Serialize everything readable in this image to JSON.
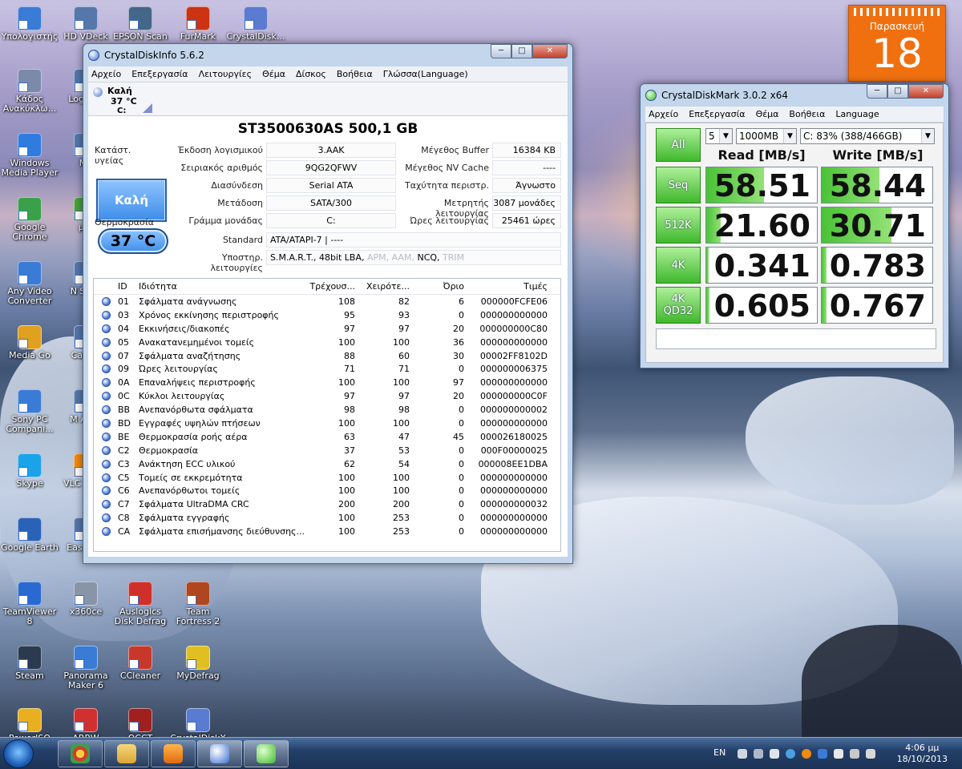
{
  "desktop": {
    "icons": [
      {
        "label": "Υπολογιστής",
        "name": "computer",
        "color": "#3a7bd5"
      },
      {
        "label": "HD VDeck",
        "name": "hd-vdeck",
        "color": "#5577aa"
      },
      {
        "label": "EPSON Scan",
        "name": "epson-scan",
        "color": "#446688"
      },
      {
        "label": "FurMark",
        "name": "furmark",
        "color": "#cc3311"
      },
      {
        "label": "CrystalDisk...",
        "name": "crystaldisk",
        "color": "#5a7bd0"
      },
      {
        "label": "Κάδος Ανακύκλω...",
        "name": "recycle-bin",
        "color": "#7a8aa8"
      },
      {
        "label": "Log Wel",
        "name": "log-wel",
        "color": "#5577aa"
      },
      {
        "label": "Windows Media Player",
        "name": "windows-media-player",
        "color": "#2f7be0"
      },
      {
        "label": "Mp",
        "name": "mp",
        "color": "#5577aa"
      },
      {
        "label": "Google Chrome",
        "name": "google-chrome",
        "color": "#3aa14a"
      },
      {
        "label": "µTo",
        "name": "utorrent",
        "color": "#4aa03a"
      },
      {
        "label": "Any Video Converter",
        "name": "any-video-converter",
        "color": "#3a7bd5"
      },
      {
        "label": "N Start",
        "name": "n-start",
        "color": "#5577aa"
      },
      {
        "label": "Media Go",
        "name": "media-go",
        "color": "#e0a020"
      },
      {
        "label": "Cat Co",
        "name": "cat-co",
        "color": "#5577aa"
      },
      {
        "label": "Sony PC Compani...",
        "name": "sony-pc-companion",
        "color": "#3a7bd5"
      },
      {
        "label": "M After",
        "name": "m-after",
        "color": "#5577aa"
      },
      {
        "label": "Skype",
        "name": "skype",
        "color": "#1aa3e8"
      },
      {
        "label": "VLC m pla",
        "name": "vlc",
        "color": "#f08a10"
      },
      {
        "label": "Google Earth",
        "name": "google-earth",
        "color": "#2a62b8"
      },
      {
        "label": "Eas Parti",
        "name": "eas-parti",
        "color": "#5577aa"
      },
      {
        "label": "TeamViewer 8",
        "name": "teamviewer",
        "color": "#2a6ad0"
      },
      {
        "label": "x360ce",
        "name": "x360ce",
        "color": "#8894a8"
      },
      {
        "label": "Auslogics Disk Defrag",
        "name": "auslogics",
        "color": "#d0302a"
      },
      {
        "label": "Team Fortress 2",
        "name": "team-fortress",
        "color": "#b0461e"
      },
      {
        "label": "Steam",
        "name": "steam",
        "color": "#2b3a4e"
      },
      {
        "label": "Panorama Maker 6",
        "name": "panorama-maker",
        "color": "#3a7bd5"
      },
      {
        "label": "CCleaner",
        "name": "ccleaner",
        "color": "#c8382a"
      },
      {
        "label": "MyDefrag",
        "name": "mydefrag",
        "color": "#e0c020"
      },
      {
        "label": "PowerISO",
        "name": "poweriso",
        "color": "#e8b020"
      },
      {
        "label": "ARRW",
        "name": "arrw",
        "color": "#d03030"
      },
      {
        "label": "OCCT",
        "name": "occt",
        "color": "#a02020"
      },
      {
        "label": "CrystalDiskX",
        "name": "crystaldiskx",
        "color": "#5a7bd0"
      }
    ]
  },
  "calendar": {
    "day": "Παρασκευή",
    "date": "18"
  },
  "cdi": {
    "title": "CrystalDiskInfo 5.6.2",
    "menu": [
      "Αρχείο",
      "Επεξεργασία",
      "Λειτουργίες",
      "Θέμα",
      "Δίσκος",
      "Βοήθεια",
      "Γλώσσα(Language)"
    ],
    "drive": {
      "status": "Καλή",
      "temp": "37 °C",
      "letter": "C:"
    },
    "model": "ST3500630AS  500,1 GB",
    "health_label": "Κατάστ. υγείας",
    "health_value": "Καλή",
    "temp_label": "Θερμοκρασία",
    "temp_value": "37 °C",
    "firmware_label": "Έκδοση λογισμικού",
    "firmware": "3.AAK",
    "serial_label": "Σειριακός αριθμός",
    "serial": "9QG2QFWV",
    "interface_label": "Διασύνδεση",
    "interface": "Serial ATA",
    "transfer_label": "Μετάδοση",
    "transfer": "SATA/300",
    "letter_label": "Γράμμα μονάδας",
    "letter": "C:",
    "standard_label": "Standard",
    "standard": "ATA/ATAPI-7 | ----",
    "features_label": "Υποστηρ. λειτουργίες",
    "features_active": "S.M.A.R.T., 48bit LBA,",
    "features_dim": " APM, AAM,",
    "features_active2": " NCQ,",
    "features_dim2": " TRIM",
    "buffer_label": "Μέγεθος Buffer",
    "buffer": "16384 KB",
    "nvcache_label": "Μέγεθος NV Cache",
    "nvcache": "----",
    "rotation_label": "Ταχύτητα περιστρ.",
    "rotation": "Άγνωστο",
    "powercount_label": "Μετρητής λειτουργίας",
    "powercount": "3087 μονάδες",
    "hours_label": "Ώρες λειτουργίας",
    "hours": "25461 ώρες",
    "columns": [
      "ID",
      "Ιδιότητα",
      "Τρέχουσ...",
      "Χειρότε...",
      "Όριο",
      "Τιμές"
    ],
    "attributes": [
      {
        "id": "01",
        "name": "Σφάλματα ανάγνωσης",
        "cur": "108",
        "worst": "82",
        "thr": "6",
        "raw": "000000FCFE06"
      },
      {
        "id": "03",
        "name": "Χρόνος εκκίνησης περιστροφής",
        "cur": "95",
        "worst": "93",
        "thr": "0",
        "raw": "000000000000"
      },
      {
        "id": "04",
        "name": "Εκκινήσεις/διακοπές",
        "cur": "97",
        "worst": "97",
        "thr": "20",
        "raw": "000000000C80"
      },
      {
        "id": "05",
        "name": "Ανακατανεμημένοι τομείς",
        "cur": "100",
        "worst": "100",
        "thr": "36",
        "raw": "000000000000"
      },
      {
        "id": "07",
        "name": "Σφάλματα αναζήτησης",
        "cur": "88",
        "worst": "60",
        "thr": "30",
        "raw": "00002FF8102D"
      },
      {
        "id": "09",
        "name": "Ώρες λειτουργίας",
        "cur": "71",
        "worst": "71",
        "thr": "0",
        "raw": "000000006375"
      },
      {
        "id": "0A",
        "name": "Επαναλήψεις περιστροφής",
        "cur": "100",
        "worst": "100",
        "thr": "97",
        "raw": "000000000000"
      },
      {
        "id": "0C",
        "name": "Κύκλοι λειτουργίας",
        "cur": "97",
        "worst": "97",
        "thr": "20",
        "raw": "000000000C0F"
      },
      {
        "id": "BB",
        "name": "Ανεπανόρθωτα σφάλματα",
        "cur": "98",
        "worst": "98",
        "thr": "0",
        "raw": "000000000002"
      },
      {
        "id": "BD",
        "name": "Εγγραφές υψηλών πτήσεων",
        "cur": "100",
        "worst": "100",
        "thr": "0",
        "raw": "000000000000"
      },
      {
        "id": "BE",
        "name": "Θερμοκρασία ροής αέρα",
        "cur": "63",
        "worst": "47",
        "thr": "45",
        "raw": "000026180025"
      },
      {
        "id": "C2",
        "name": "Θερμοκρασία",
        "cur": "37",
        "worst": "53",
        "thr": "0",
        "raw": "000F00000025"
      },
      {
        "id": "C3",
        "name": "Ανάκτηση ECC υλικού",
        "cur": "62",
        "worst": "54",
        "thr": "0",
        "raw": "000008EE1DBA"
      },
      {
        "id": "C5",
        "name": "Τομείς σε εκκρεμότητα",
        "cur": "100",
        "worst": "100",
        "thr": "0",
        "raw": "000000000000"
      },
      {
        "id": "C6",
        "name": "Ανεπανόρθωτοι τομείς",
        "cur": "100",
        "worst": "100",
        "thr": "0",
        "raw": "000000000000"
      },
      {
        "id": "C7",
        "name": "Σφάλματα UltraDMA CRC",
        "cur": "200",
        "worst": "200",
        "thr": "0",
        "raw": "000000000032"
      },
      {
        "id": "C8",
        "name": "Σφάλματα εγγραφής",
        "cur": "100",
        "worst": "253",
        "thr": "0",
        "raw": "000000000000"
      },
      {
        "id": "CA",
        "name": "Σφάλματα επισήμανσης διεύθυνσης...",
        "cur": "100",
        "worst": "253",
        "thr": "0",
        "raw": "000000000000"
      }
    ]
  },
  "cdm": {
    "title": "CrystalDiskMark 3.0.2 x64",
    "menu": [
      "Αρχείο",
      "Επεξεργασία",
      "Θέμα",
      "Βοήθεια",
      "Language"
    ],
    "all_label": "All",
    "count": "5",
    "size": "1000MB",
    "drive": "C: 83% (388/466GB)",
    "read_header": "Read [MB/s]",
    "write_header": "Write [MB/s]",
    "rows": [
      {
        "label": "Seq",
        "read": "58.51",
        "write": "58.44",
        "read_fill": 0.52,
        "write_fill": 0.52
      },
      {
        "label": "512K",
        "read": "21.60",
        "write": "30.71",
        "read_fill": 0.13,
        "write_fill": 0.63
      },
      {
        "label": "4K",
        "read": "0.341",
        "write": "0.783",
        "read_fill": 0.02,
        "write_fill": 0.04
      },
      {
        "label": "4K QD32",
        "read": "0.605",
        "write": "0.767",
        "read_fill": 0.03,
        "write_fill": 0.04
      }
    ]
  },
  "taskbar": {
    "lang": "EN",
    "time": "4:06 μμ",
    "date": "18/10/2013"
  },
  "colors": {
    "accent": "#3fb82c",
    "health": "#3f8dea",
    "calendar": "#f0700f"
  }
}
